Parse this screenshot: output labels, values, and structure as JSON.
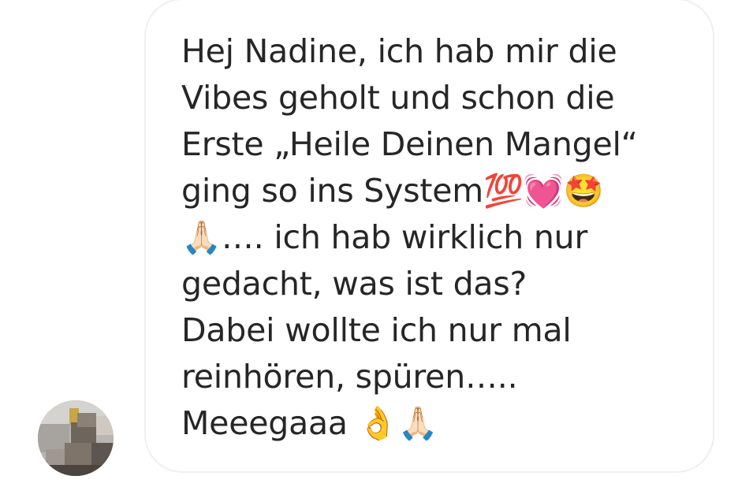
{
  "conversation": {
    "incoming_message": {
      "text": "Hej Nadine, ich hab mir die\nVibes geholt und schon die\nErste „Heile Deinen Mangel“\nging so ins System💯💓🤩\n🙏🏻…. ich hab wirklich nur\ngedacht, was ist das?\nDabei wollte ich nur mal\nreinhören, spüren…..\nMeeegaaa 👌🙏🏻",
      "sender_avatar": "blurred-profile-photo"
    }
  },
  "colors": {
    "background": "#ffffff",
    "bubble_border": "#efefef",
    "text": "#262626"
  }
}
